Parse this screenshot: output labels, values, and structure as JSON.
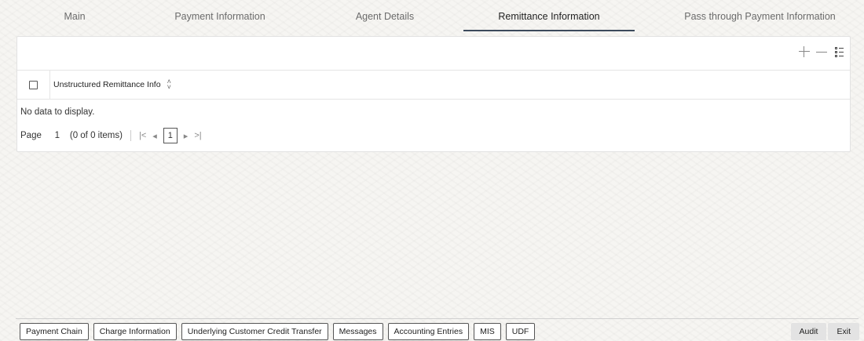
{
  "tabs": [
    {
      "label": "Main"
    },
    {
      "label": "Payment Information"
    },
    {
      "label": "Agent Details"
    },
    {
      "label": "Remittance Information",
      "active": true
    },
    {
      "label": "Pass through Payment Information"
    }
  ],
  "grid": {
    "column_header": "Unstructured Remittance Info",
    "empty_message": "No data to display.",
    "pager": {
      "page_label": "Page",
      "page_value": "1",
      "items_text": "(0 of 0 items)",
      "current_page": "1"
    },
    "toolbar_icons": [
      "add-icon",
      "remove-icon",
      "column-list-icon"
    ]
  },
  "footer": {
    "buttons": [
      "Payment Chain",
      "Charge Information",
      "Underlying Customer Credit Transfer",
      "Messages",
      "Accounting Entries",
      "MIS",
      "UDF"
    ],
    "right_buttons": [
      "Audit",
      "Exit"
    ]
  },
  "colors": {
    "active_tab_underline": "#3c4a5c",
    "background": "#f6f5f2"
  }
}
